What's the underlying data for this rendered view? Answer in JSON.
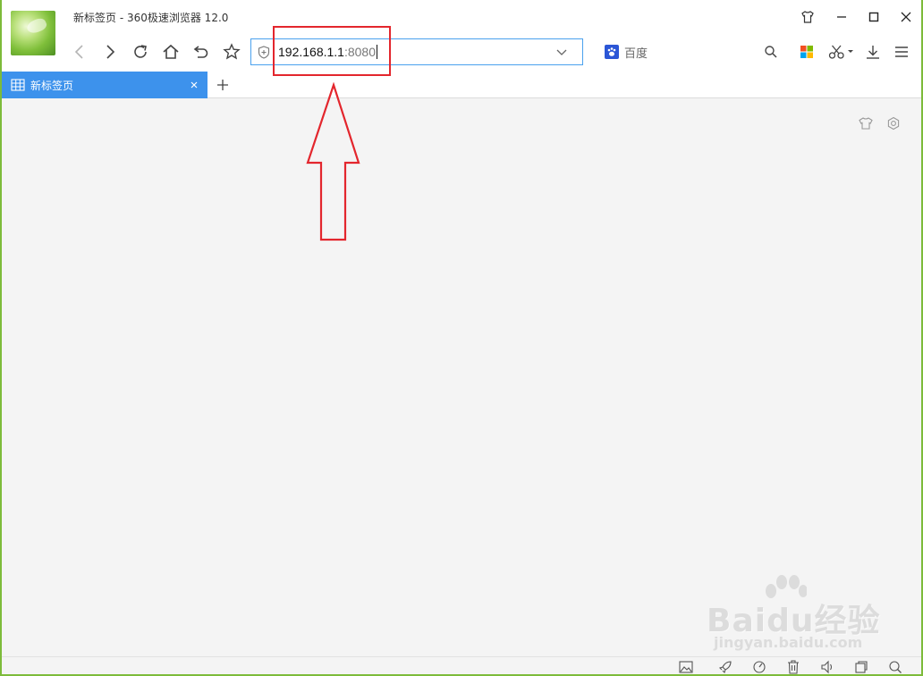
{
  "window": {
    "title": "新标签页 - 360极速浏览器 12.0"
  },
  "address_bar": {
    "host": "192.168.1.1",
    "port": ":8080"
  },
  "search_engine": {
    "label": "百度",
    "icon": "baidu-paw-icon"
  },
  "tabs": [
    {
      "label": "新标签页",
      "active": true,
      "icon": "grid-icon"
    }
  ],
  "toolbar": {
    "icons": [
      "back-icon",
      "forward-icon",
      "reload-icon",
      "home-icon",
      "undo-icon",
      "star-icon"
    ],
    "right_icons": [
      "search-icon",
      "apps-icon",
      "scissors-icon",
      "download-icon",
      "menu-icon"
    ]
  },
  "window_controls": [
    "skin-icon",
    "minimize-icon",
    "maximize-icon",
    "close-icon"
  ],
  "statusbar": {
    "icons": [
      "image-icon",
      "rocket-icon",
      "speed-icon",
      "trash-icon",
      "volume-icon",
      "window-icon",
      "zoom-icon"
    ]
  },
  "watermark": {
    "main": "Baidu经验",
    "sub": "jingyan.baidu.com"
  },
  "colors": {
    "accent": "#3d92ec",
    "address_border": "#4aa1ee",
    "annotation": "#e3262d",
    "frame": "#7dbb3a"
  }
}
